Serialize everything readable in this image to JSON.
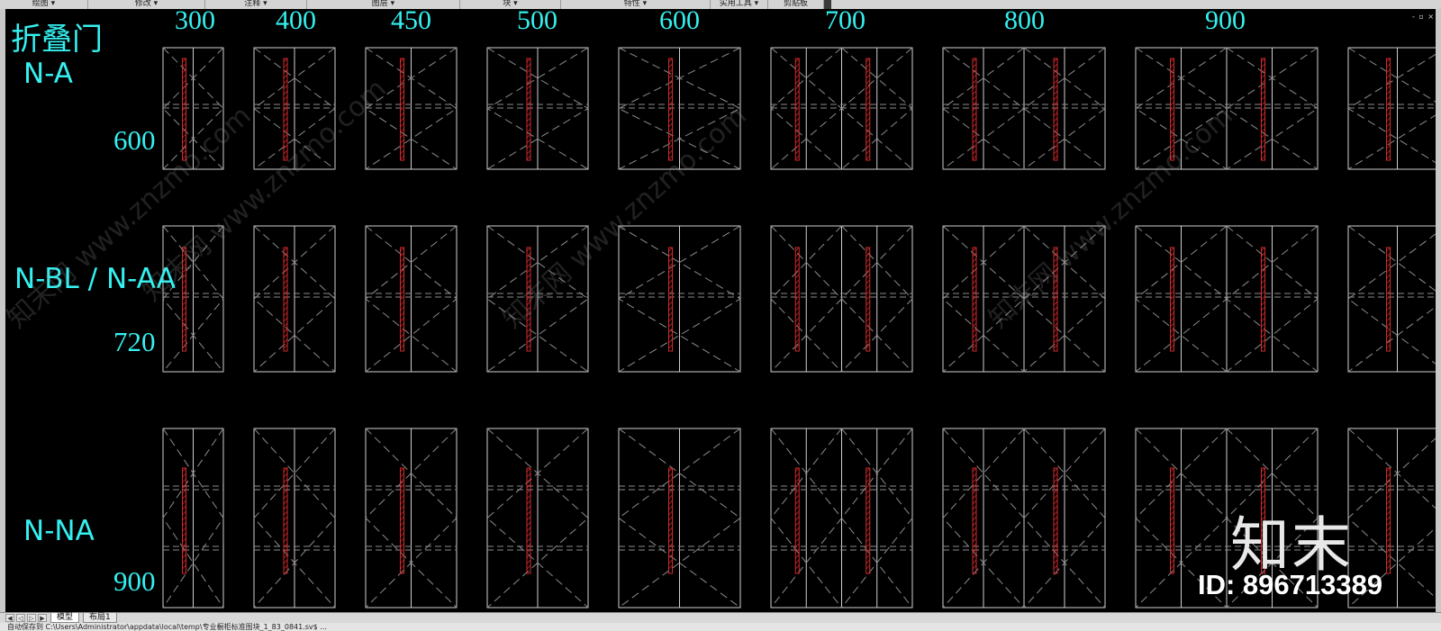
{
  "ribbon": {
    "panels": [
      {
        "label": "绘图 ▾"
      },
      {
        "label": "修改 ▾"
      },
      {
        "label": "注释 ▾"
      },
      {
        "label": "图层 ▾"
      },
      {
        "label": "块 ▾"
      },
      {
        "label": "特性 ▾"
      },
      {
        "label": "实用工具 ▾"
      },
      {
        "label": "剪贴板"
      }
    ]
  },
  "viewport": {
    "controls": "- ▫ ×"
  },
  "drawing": {
    "title": "折叠门",
    "widths": [
      "300",
      "400",
      "450",
      "500",
      "600",
      "700",
      "800",
      "900"
    ],
    "rows": [
      {
        "type": "N-A",
        "height": "600"
      },
      {
        "type": "N-BL / N-AA",
        "height": "720"
      },
      {
        "type": "N-NA",
        "height": "900"
      }
    ],
    "colors": {
      "text": "#35f0f0",
      "line": "#cfcfcf",
      "dash": "#8c8c8c",
      "hinge": "#d42a2a"
    },
    "watermark": "知末网 www.znzmo.com"
  },
  "logo": {
    "glyph": "知末",
    "id_text": "ID: 896713389"
  },
  "tabs": {
    "nav": [
      "◀",
      "◁",
      "▷",
      "▶"
    ],
    "items": [
      "模型",
      "布局1"
    ]
  },
  "cmdline": {
    "text": "自动保存到 C:\\Users\\Administrator\\appdata\\local\\temp\\专业橱柜标准图块_1_83_0841.sv$ ..."
  }
}
